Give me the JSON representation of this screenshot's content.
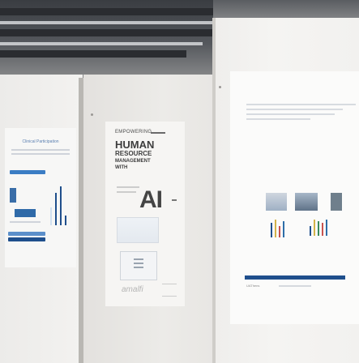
{
  "scene": {
    "description_alt": "Photo of scientific posters displayed on white boards in a hall"
  },
  "poster_left": {
    "heading": "Clinical Participation"
  },
  "poster_center": {
    "kicker": "EMPOWERING",
    "title_line1": "HUMAN",
    "title_line2": "RESOURCE",
    "title_line3": "MANAGEMENT",
    "title_line4": "WITH",
    "title_ai": "AI",
    "logo": "amalfi"
  },
  "poster_right": {
    "footer": "UAThens"
  },
  "colors": {
    "accent_blue": "#1f4f8c",
    "wall": "#efeeec",
    "ceiling": "#3a3d42"
  }
}
